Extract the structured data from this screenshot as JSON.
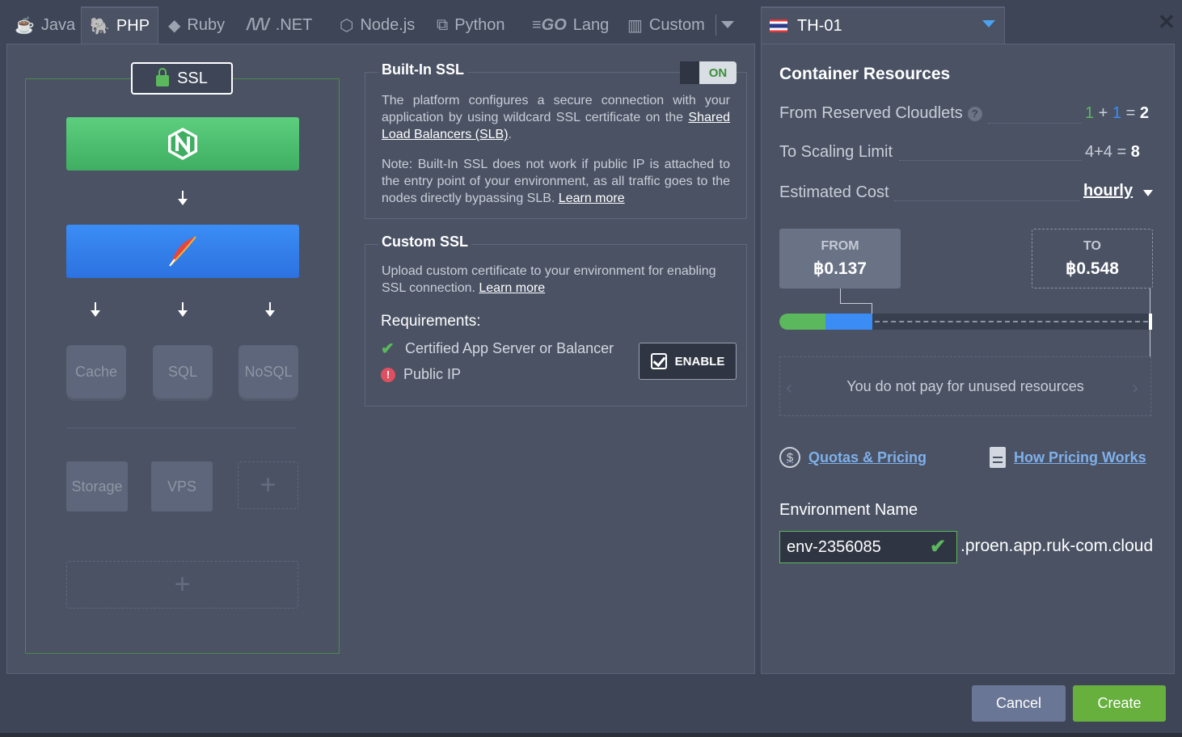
{
  "tabs": [
    {
      "label": "Java",
      "icon": "java-icon"
    },
    {
      "label": "PHP",
      "icon": "php-icon",
      "active": true
    },
    {
      "label": "Ruby",
      "icon": "ruby-icon"
    },
    {
      "label": ".NET",
      "icon": "dotnet-icon"
    },
    {
      "label": "Node.js",
      "icon": "nodejs-icon"
    },
    {
      "label": "Python",
      "icon": "python-icon"
    },
    {
      "label": "Lang",
      "icon": "go-icon"
    },
    {
      "label": "Custom",
      "icon": "custom-icon"
    }
  ],
  "topology": {
    "ssl_label": "SSL",
    "nodes": {
      "cache": "Cache",
      "sql": "SQL",
      "nosql": "NoSQL",
      "storage": "Storage",
      "vps": "VPS"
    },
    "plus": "+"
  },
  "builtin_ssl": {
    "title": "Built-In SSL",
    "toggle": "ON",
    "p1_text": "The platform configures a secure connection with your application by using wildcard SSL certificate on the ",
    "p1_link": "Shared Load Balancers (SLB)",
    "p1_end": ".",
    "p2_text": "Note: Built-In SSL does not work if public IP is attached to the entry point of your environment, as all traffic goes to the nodes directly bypassing SLB. ",
    "p2_link": "Learn more"
  },
  "custom_ssl": {
    "title": "Custom SSL",
    "p_text": "Upload custom certificate to your environment for enabling SSL connection. ",
    "p_link": "Learn more",
    "req_title": "Requirements:",
    "req1": "Certified App Server or Balancer",
    "req2": "Public IP",
    "enable": "ENABLE"
  },
  "region": {
    "name": "TH-01"
  },
  "resources": {
    "title": "Container Resources",
    "reserved_label": "From Reserved Cloudlets",
    "reserved_a": "1",
    "reserved_b": "1",
    "reserved_total": "2",
    "scaling_label": "To Scaling Limit",
    "scaling_expr": "4+4 =",
    "scaling_total": "8",
    "cost_label": "Estimated Cost",
    "cost_period": "hourly",
    "from_label": "FROM",
    "from_value": "฿0.137",
    "to_label": "TO",
    "to_value": "฿0.548",
    "info": "You do not pay for unused resources",
    "quotas_link": "Quotas & Pricing",
    "how_link": "How Pricing Works"
  },
  "env": {
    "label": "Environment Name",
    "value": "env-2356085",
    "suffix": ".proen.app.ruk-com.cloud"
  },
  "buttons": {
    "cancel": "Cancel",
    "create": "Create"
  },
  "colors": {
    "accent_green": "#5cb85c",
    "accent_blue": "#3b8df5",
    "create_btn": "#67b03e",
    "cancel_btn": "#6a7695"
  }
}
